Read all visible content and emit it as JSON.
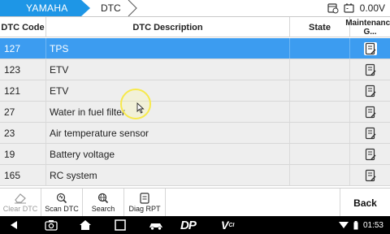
{
  "header": {
    "brand": "YAMAHA",
    "section": "DTC",
    "voltage": "0.00V"
  },
  "table": {
    "columns": [
      "DTC Code",
      "DTC Description",
      "State",
      "Maintenance G..."
    ],
    "rows": [
      {
        "code": "127",
        "description": "TPS",
        "state": ""
      },
      {
        "code": "123",
        "description": "ETV",
        "state": ""
      },
      {
        "code": "121",
        "description": "ETV",
        "state": ""
      },
      {
        "code": "27",
        "description": "Water in fuel filter",
        "state": ""
      },
      {
        "code": "23",
        "description": "Air temperature sensor",
        "state": ""
      },
      {
        "code": "19",
        "description": "Battery voltage",
        "state": ""
      },
      {
        "code": "165",
        "description": "RC system",
        "state": ""
      }
    ]
  },
  "toolbar": {
    "clear_dtc": "Clear DTC",
    "scan_dtc": "Scan DTC",
    "search": "Search",
    "diag_rpt": "Diag RPT",
    "back": "Back"
  },
  "navbar": {
    "dp_logo": "DP",
    "vci_logo": "V",
    "vci_sub": "CI",
    "time": "01:53"
  },
  "colors": {
    "accent": "#1e96e6",
    "selected_row": "#3c9cf0",
    "row_bg": "#eeeeee",
    "cursor_highlight": "#f7e94a"
  }
}
